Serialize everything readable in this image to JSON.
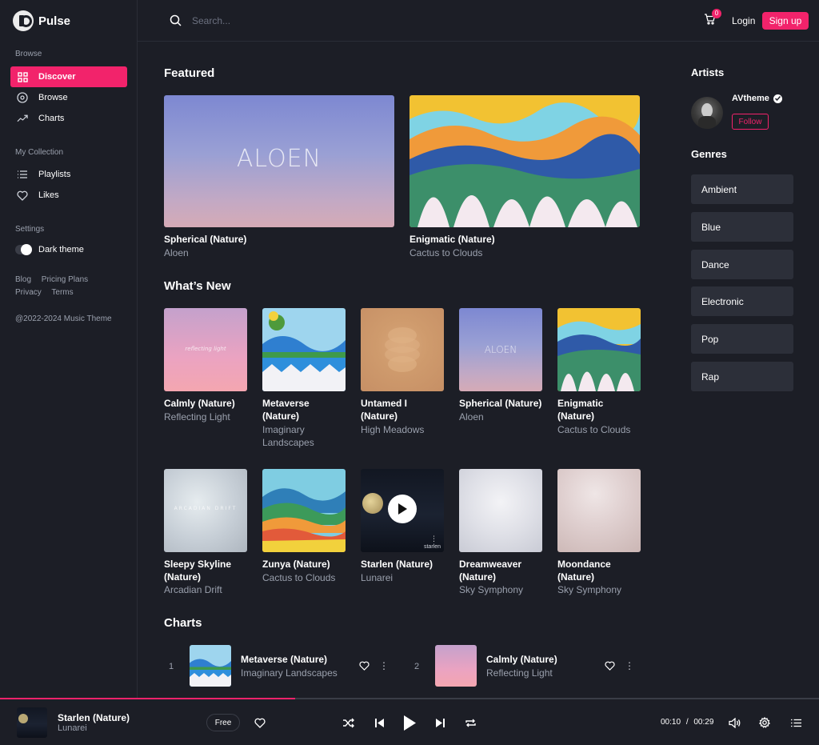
{
  "app": {
    "name": "Pulse"
  },
  "colors": {
    "accent": "#f2236b",
    "background": "#1c1e26",
    "card": "#2c2f39"
  },
  "sidebar": {
    "browse_title": "Browse",
    "browse_items": [
      {
        "label": "Discover",
        "icon": "grid-icon",
        "active": true
      },
      {
        "label": "Browse",
        "icon": "disc-icon"
      },
      {
        "label": "Charts",
        "icon": "trend-icon"
      }
    ],
    "collection_title": "My Collection",
    "collection_items": [
      {
        "label": "Playlists",
        "icon": "list-icon"
      },
      {
        "label": "Likes",
        "icon": "heart-icon"
      }
    ],
    "settings_title": "Settings",
    "dark_theme_label": "Dark theme",
    "links": [
      "Blog",
      "Pricing Plans",
      "Privacy",
      "Terms"
    ],
    "copyright": "@2022-2024 Music Theme"
  },
  "topbar": {
    "search_placeholder": "Search...",
    "cart_count": "0",
    "login_label": "Login",
    "signup_label": "Sign up"
  },
  "featured": {
    "title": "Featured",
    "items": [
      {
        "title": "Spherical (Nature)",
        "artist": "Aloen",
        "cover_text": "ALOEN"
      },
      {
        "title": "Enigmatic (Nature)",
        "artist": "Cactus to Clouds"
      }
    ]
  },
  "whats_new": {
    "title": "What’s New",
    "row1": [
      {
        "title": "Calmly (Nature)",
        "artist": "Reflecting Light",
        "cover_text": "reflecting light"
      },
      {
        "title": "Metaverse (Nature)",
        "artist": "Imaginary Landscapes"
      },
      {
        "title": "Untamed I (Nature)",
        "artist": "High Meadows"
      },
      {
        "title": "Spherical (Nature)",
        "artist": "Aloen",
        "cover_text": "ALOEN"
      },
      {
        "title": "Enigmatic (Nature)",
        "artist": "Cactus to Clouds"
      }
    ],
    "row2": [
      {
        "title": "Sleepy Skyline (Nature)",
        "artist": "Arcadian Drift",
        "cover_text": "ARCADIAN DRIFT"
      },
      {
        "title": "Zunya (Nature)",
        "artist": "Cactus to Clouds"
      },
      {
        "title": "Starlen (Nature)",
        "artist": "Lunarei",
        "cover_text": "starlen"
      },
      {
        "title": "Dreamweaver (Nature)",
        "artist": "Sky Symphony"
      },
      {
        "title": "Moondance (Nature)",
        "artist": "Sky Symphony"
      }
    ]
  },
  "right": {
    "artists_title": "Artists",
    "artist_name": "AVtheme",
    "follow_label": "Follow",
    "genres_title": "Genres",
    "genres": [
      "Ambient",
      "Blue",
      "Dance",
      "Electronic",
      "Pop",
      "Rap"
    ]
  },
  "charts": {
    "title": "Charts",
    "items": [
      {
        "rank": "1",
        "title": "Metaverse (Nature)",
        "artist": "Imaginary Landscapes"
      },
      {
        "rank": "2",
        "title": "Calmly (Nature)",
        "artist": "Reflecting Light"
      }
    ]
  },
  "player": {
    "title": "Starlen (Nature)",
    "artist": "Lunarei",
    "free_label": "Free",
    "current_time": "00:10",
    "separator": "/",
    "duration": "00:29",
    "progress": 0.36
  }
}
